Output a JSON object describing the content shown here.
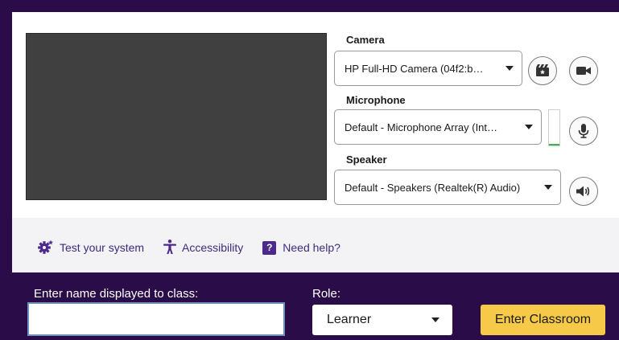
{
  "camera": {
    "label": "Camera",
    "selected": "HP Full-HD Camera (04f2:b…",
    "effects_icon": "video-effects-icon",
    "toggle_icon": "video-camera-icon"
  },
  "microphone": {
    "label": "Microphone",
    "selected": "Default - Microphone Array (Int…",
    "level": 0.05,
    "toggle_icon": "microphone-icon"
  },
  "speaker": {
    "label": "Speaker",
    "selected": "Default - Speakers (Realtek(R) Audio)",
    "test_icon": "speaker-icon"
  },
  "links": {
    "test_system": "Test your system",
    "accessibility": "Accessibility",
    "help_glyph": "?",
    "need_help": "Need help?"
  },
  "entry": {
    "name_label": "Enter name displayed to class:",
    "name_value": "",
    "role_label": "Role:",
    "role_selected": "Learner",
    "enter_button": "Enter Classroom"
  },
  "colors": {
    "header_bg": "#2a0d48",
    "accent": "#4b2a8c",
    "button": "#f7c948",
    "level": "#3cb44a"
  }
}
